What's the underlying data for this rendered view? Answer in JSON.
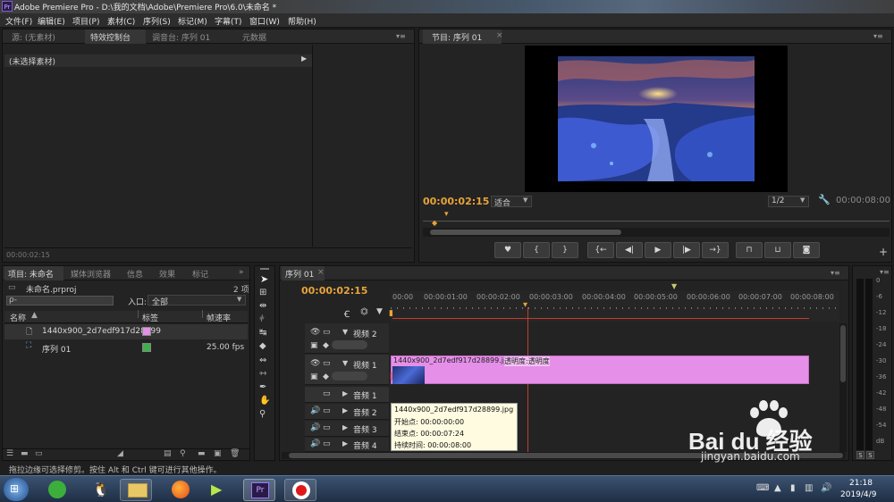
{
  "window": {
    "title": "Adobe Premiere Pro - D:\\我的文档\\Adobe\\Premiere Pro\\6.0\\未命名 *",
    "app_icon": "Pr"
  },
  "menu": [
    "文件(F)",
    "编辑(E)",
    "项目(P)",
    "素材(C)",
    "序列(S)",
    "标记(M)",
    "字幕(T)",
    "窗口(W)",
    "帮助(H)"
  ],
  "source_panel": {
    "tabs": [
      "源: (无素材)",
      "特效控制台",
      "调音台: 序列 01",
      "元数据"
    ],
    "no_clip": "(未选择素材)",
    "timecode": "00:00:02:15"
  },
  "program_panel": {
    "tab": "节目: 序列 01",
    "timecode": "00:00:02:15",
    "fit": "适合",
    "resolution": "1/2",
    "duration": "00:00:08:00"
  },
  "project_panel": {
    "tabs": [
      "项目: 未命名",
      "媒体浏览器",
      "信息",
      "效果",
      "标记"
    ],
    "project_file": "未命名.prproj",
    "item_count": "2 项",
    "search_placeholder": "ρ-",
    "in_label": "入口:",
    "in_value": "全部",
    "columns": [
      "名称",
      "标签",
      "帧速率"
    ],
    "items": [
      {
        "name": "1440x900_2d7edf917d28899",
        "label_color": "#e58fe8",
        "fps": ""
      },
      {
        "name": "序列 01",
        "label_color": "#3db24a",
        "fps": "25.00 fps"
      }
    ]
  },
  "timeline": {
    "tab": "序列 01",
    "timecode": "00:00:02:15",
    "ruler": [
      "00:00",
      "00:00:01:00",
      "00:00:02:00",
      "00:00:03:00",
      "00:00:04:00",
      "00:00:05:00",
      "00:00:06:00",
      "00:00:07:00",
      "00:00:08:00"
    ],
    "video_tracks": [
      "视频 2",
      "视频 1"
    ],
    "audio_tracks": [
      "音频 1",
      "音频 2",
      "音频 3",
      "音频 4"
    ],
    "clip": {
      "name": "1440x900_2d7edf917d28899.jpg",
      "effect": "透明度:透明度"
    },
    "tooltip": {
      "title": "1440x900_2d7edf917d28899.jpg",
      "start": "开始点: 00:00:00:00",
      "end": "结束点: 00:00:07:24",
      "duration": "持续时间: 00:00:08:00"
    }
  },
  "meter": {
    "labels": [
      "0",
      "-6",
      "-12",
      "-18",
      "-24",
      "-30",
      "-36",
      "-42",
      "-48",
      "-54",
      "dB"
    ],
    "solo": [
      "S",
      "S"
    ]
  },
  "status_text": "拖拉边缘可选择修剪。按住 Alt 和 Ctrl 键可进行其他操作。",
  "clock": {
    "time": "21:18",
    "date": "2019/4/9"
  },
  "watermark": {
    "brand": "Bai du 经验",
    "url": "jingyan.baidu.com"
  }
}
